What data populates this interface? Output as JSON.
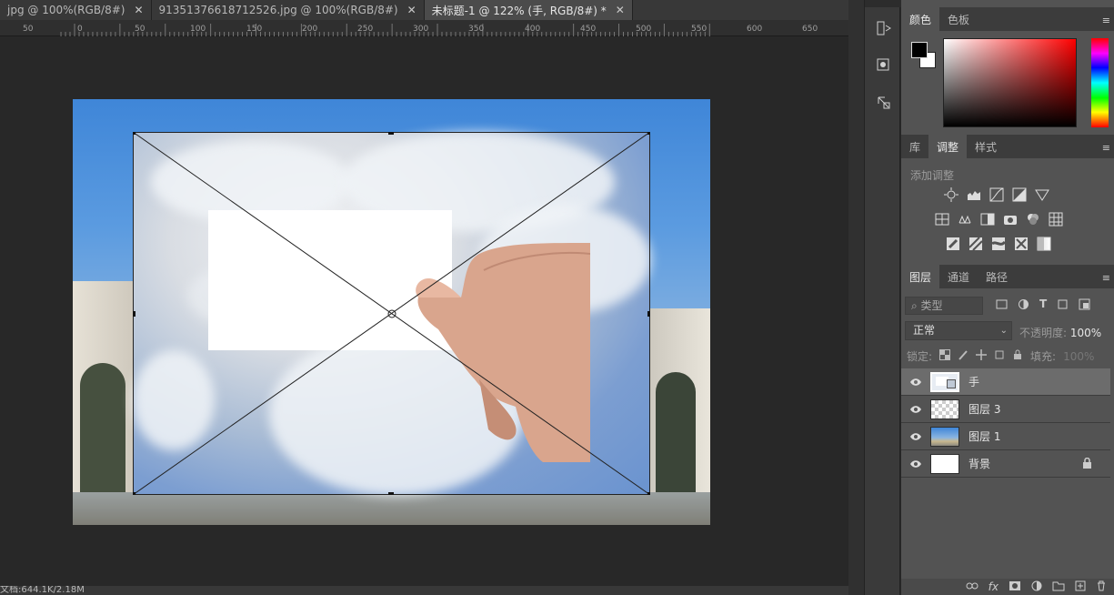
{
  "tabs": [
    {
      "label": "jpg @ 100%(RGB/8#)",
      "active": false
    },
    {
      "label": "913513766187125​26.jpg @ 100%(RGB/8#)",
      "active": false
    },
    {
      "label": "未标题-1 @ 122% (手, RGB/8#) *",
      "active": true
    }
  ],
  "ruler": {
    "ticks": [
      "50",
      "0",
      "50",
      "100",
      "150",
      "200",
      "250",
      "300",
      "350",
      "400",
      "450",
      "500",
      "550",
      "600",
      "650"
    ]
  },
  "status": {
    "doc_info": "文档:644.1K/2.18M"
  },
  "color_panel": {
    "tabs": [
      "颜色",
      "色板"
    ],
    "foreground": "#000000",
    "background": "#ffffff"
  },
  "adjust_panel": {
    "tabs": [
      "库",
      "调整",
      "样式"
    ],
    "title": "添加调整"
  },
  "layers_panel": {
    "tabs": [
      "图层",
      "通道",
      "路径"
    ],
    "search_placeholder": "类型",
    "blend_mode": "正常",
    "opacity_label": "不透明度:",
    "opacity_value": "100%",
    "lock_label": "锁定:",
    "fill_label": "填充:",
    "fill_value": "100%",
    "layers": [
      {
        "name": "手",
        "selected": true
      },
      {
        "name": "图层 3",
        "selected": false
      },
      {
        "name": "图层 1",
        "selected": false
      },
      {
        "name": "背景",
        "selected": false,
        "locked": true
      }
    ]
  }
}
